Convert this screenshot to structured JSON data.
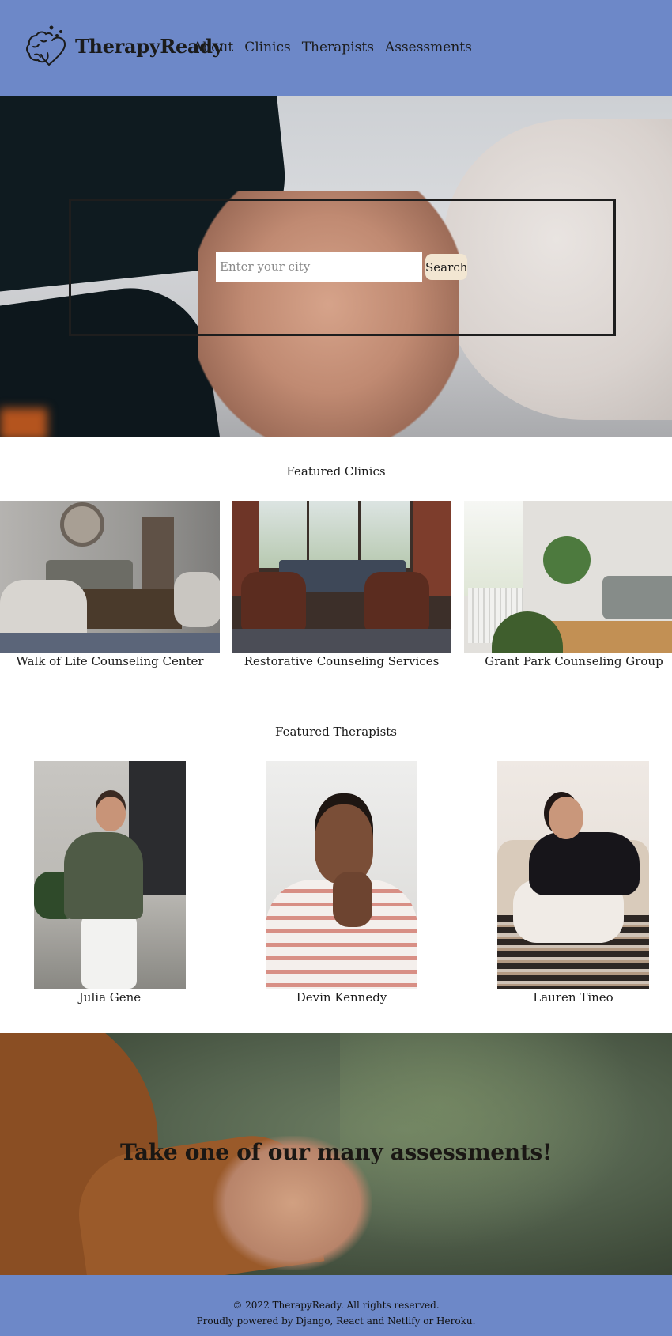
{
  "header": {
    "brand": "TherapyReady",
    "logo_icon": "brain-heart-icon",
    "nav": [
      {
        "label": "About"
      },
      {
        "label": "Clinics"
      },
      {
        "label": "Therapists"
      },
      {
        "label": "Assessments"
      }
    ]
  },
  "hero": {
    "search_placeholder": "Enter your city",
    "search_value": "",
    "search_button": "Search"
  },
  "featured_clinics": {
    "title": "Featured Clinics",
    "items": [
      {
        "name": "Walk of Life Counseling Center"
      },
      {
        "name": "Restorative Counseling Services"
      },
      {
        "name": "Grant Park Counseling Group"
      }
    ]
  },
  "featured_therapists": {
    "title": "Featured Therapists",
    "items": [
      {
        "name": "Julia Gene"
      },
      {
        "name": "Devin Kennedy"
      },
      {
        "name": "Lauren Tineo"
      }
    ]
  },
  "assessments_banner": {
    "text": "Take one of our many assessments!"
  },
  "footer": {
    "copyright": "© 2022 TherapyReady. All rights reserved.",
    "powered": "Proudly powered by Django, React and Netlify or Heroku."
  },
  "colors": {
    "header_bg": "#6d88c8",
    "search_button_bg": "#f2e6d2"
  }
}
